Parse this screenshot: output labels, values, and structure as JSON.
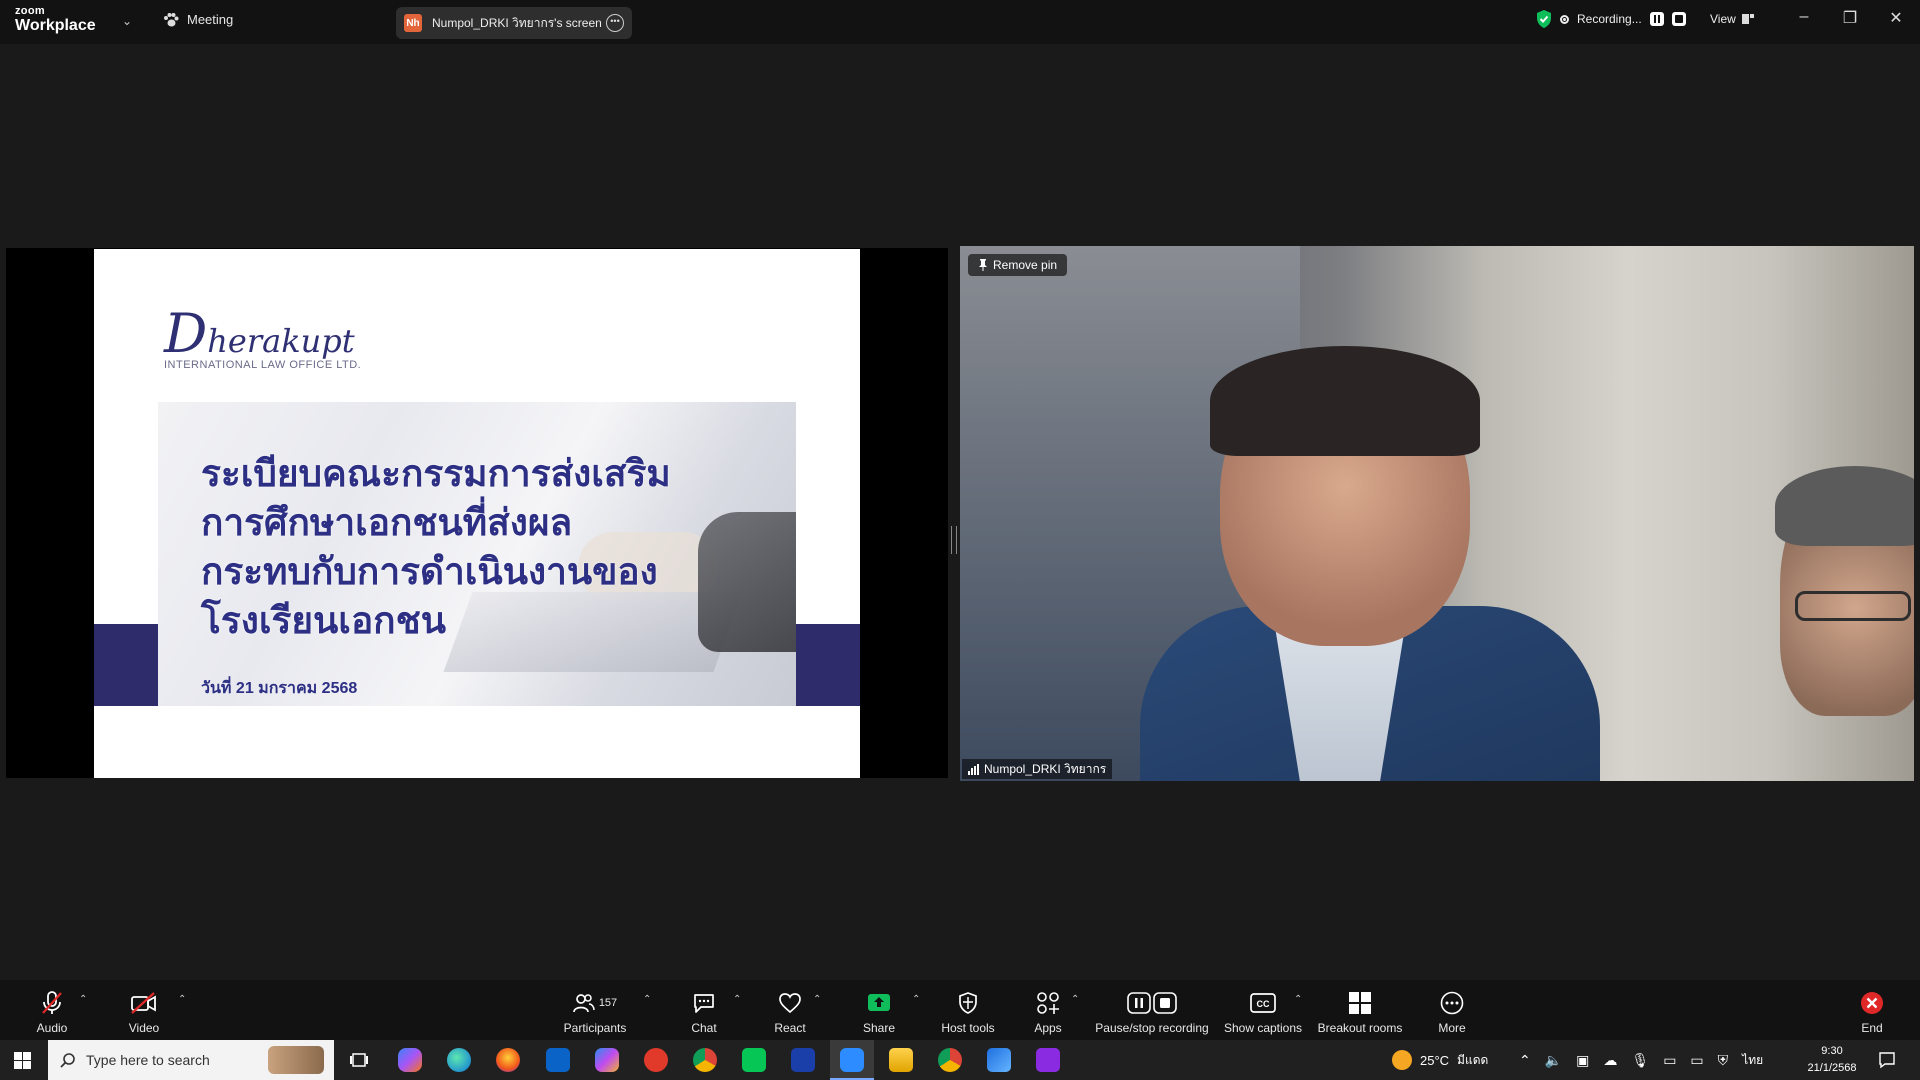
{
  "app": {
    "brand_small": "zoom",
    "brand_large": "Workplace",
    "meeting_label": "Meeting"
  },
  "share_pill": {
    "avatar_initials": "Nh",
    "label": "Numpol_DRKI วิทยากร's screen"
  },
  "recording": {
    "label": "Recording..."
  },
  "view": {
    "label": "View"
  },
  "slide": {
    "logo_initial": "D",
    "logo_rest": "herakupt",
    "logo_sub": "INTERNATIONAL LAW OFFICE LTD.",
    "title_lines": [
      "ระเบียบคณะกรรมการส่งเสริม",
      "การศึกษาเอกชนที่ส่งผล",
      "กระทบกับการดำเนินงานของ",
      "โรงเรียนเอกชน"
    ],
    "date": "วันที่ 21 มกราคม 2568"
  },
  "video": {
    "pin_label": "Remove pin",
    "name": "Numpol_DRKI วิทยากร"
  },
  "toolbar": {
    "audio": "Audio",
    "video": "Video",
    "participants": "Participants",
    "participants_count": "157",
    "chat": "Chat",
    "react": "React",
    "share": "Share",
    "host_tools": "Host tools",
    "apps": "Apps",
    "pause_stop": "Pause/stop recording",
    "captions": "Show captions",
    "breakout": "Breakout rooms",
    "more": "More",
    "end": "End"
  },
  "taskbar": {
    "search_placeholder": "Type here to search",
    "weather": "25°C",
    "weather_text": "มีแดด",
    "lang": "ไทย",
    "time": "9:30",
    "date": "21/1/2568"
  },
  "colors": {
    "accent_green": "#0fbd5a",
    "end_red": "#e02828",
    "slide_blue": "#2c2f83",
    "band": "#2e2c6a"
  }
}
